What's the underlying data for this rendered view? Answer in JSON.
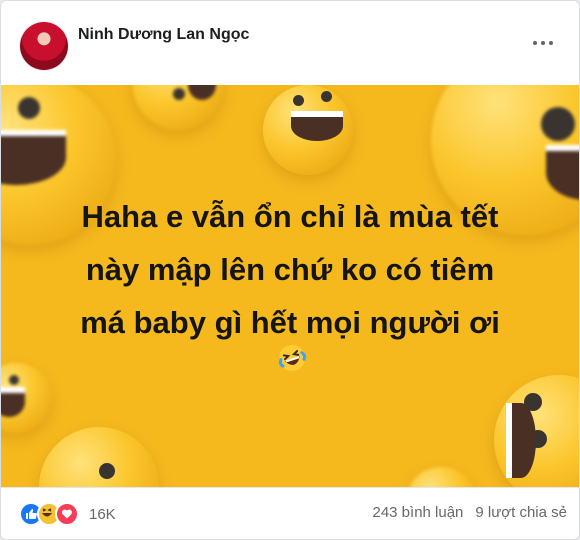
{
  "post": {
    "author": "Ninh Dương Lan Ngọc",
    "text_lines": [
      "Haha e vẫn ổn chỉ là mùa tết",
      "này mập lên chứ ko có tiêm",
      "má baby gì hết mọi người ơi"
    ],
    "text_emoji": "😂",
    "background_color": "#f5b91e"
  },
  "footer": {
    "reactions": [
      "like-icon",
      "haha-icon",
      "love-icon"
    ],
    "reaction_count": "16K",
    "comments": "243 bình luận",
    "shares": "9 lượt chia sẻ"
  }
}
